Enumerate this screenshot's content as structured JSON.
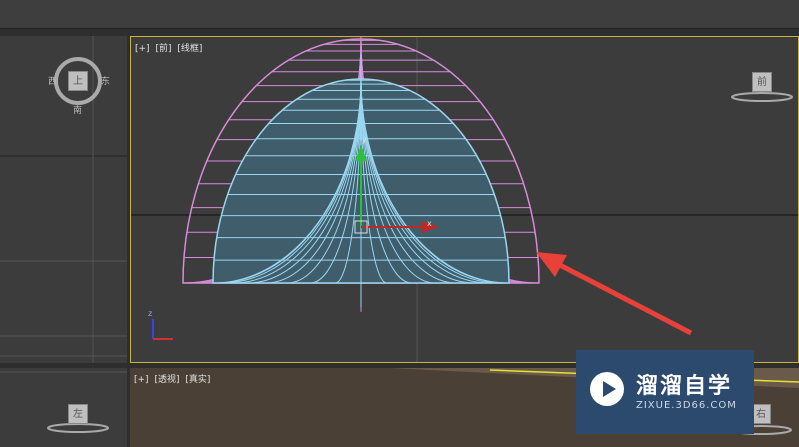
{
  "viewports": {
    "front": {
      "plus": "[+]",
      "view": "[前]",
      "shading": "[线框]",
      "cube_label": "前"
    },
    "top_left": {
      "cube_label": "上",
      "compass_w": "西",
      "compass_e": "东",
      "compass_s": "南"
    },
    "perspective": {
      "plus": "[+]",
      "view": "[透视]",
      "shading": "[真实]",
      "cube_label": "右"
    },
    "bottom_left": {
      "cube_label": "左"
    }
  },
  "gizmo": {
    "y_label": "y",
    "x_label": "x",
    "z_label": "z"
  },
  "watermark": {
    "title": "溜溜自学",
    "subtitle": "ZIXUE.3D66.COM"
  },
  "colors": {
    "outer_wireframe": "#d98bd9",
    "inner_wireframe": "#9ad6f0",
    "inner_fill": "#3f5d6b",
    "arrow": "#e8413a",
    "viewport_border": "#c8b43c",
    "watermark_bg": "#2c4a6e"
  }
}
